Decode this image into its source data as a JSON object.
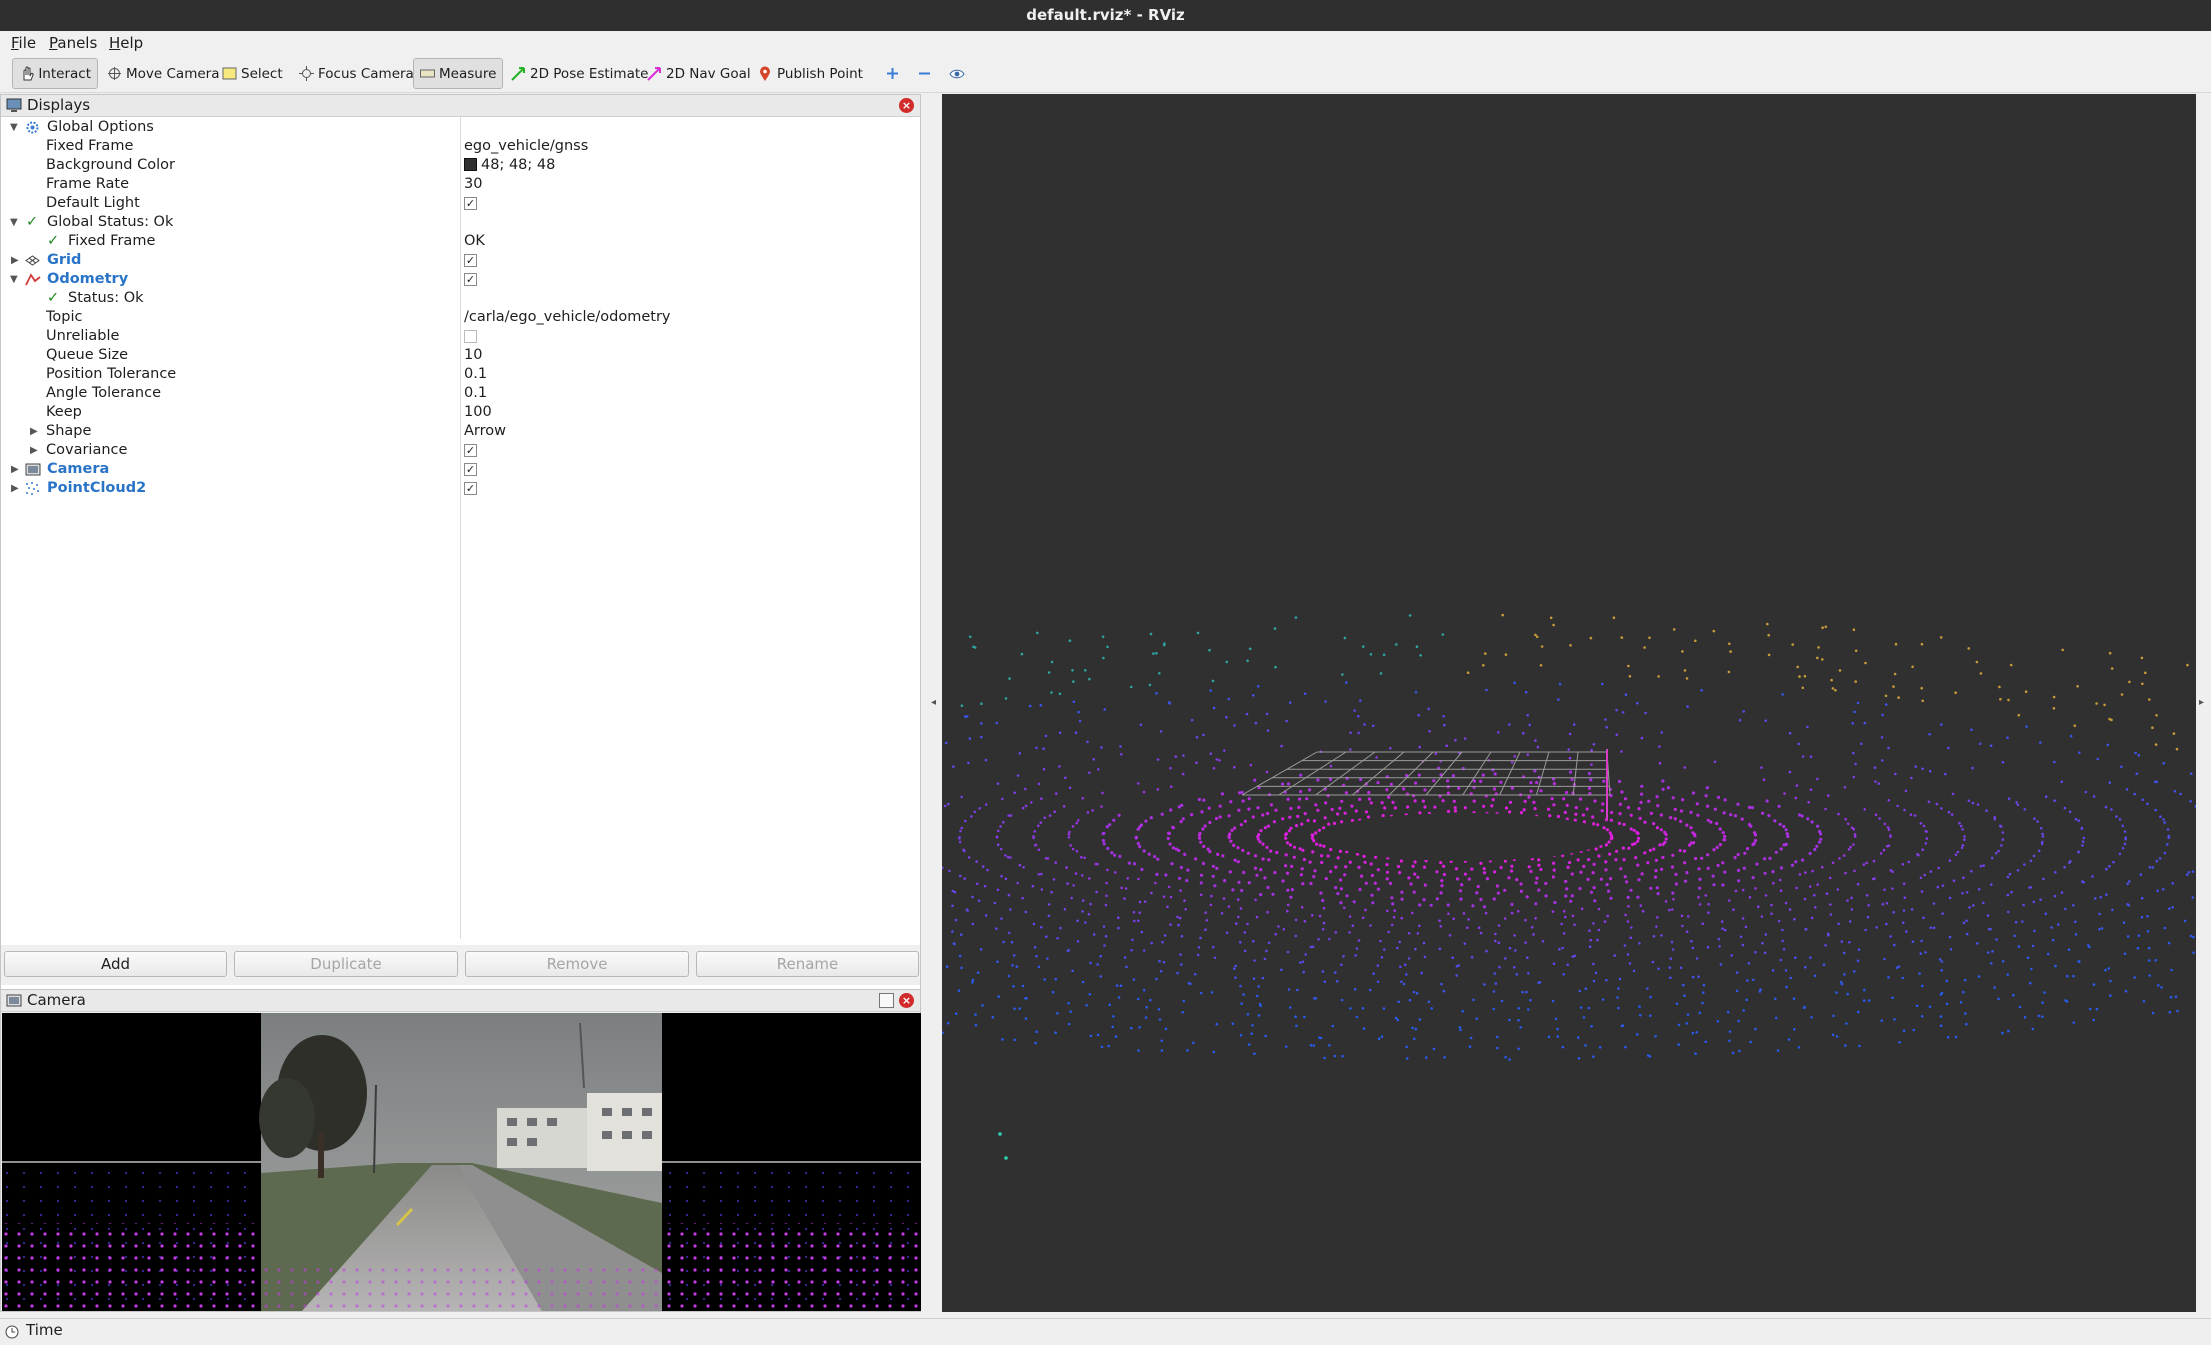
{
  "window": {
    "title": "default.rviz* - RViz"
  },
  "menu": {
    "file": "File",
    "panels": "Panels",
    "help": "Help"
  },
  "toolbar": {
    "interact": "Interact",
    "move_camera": "Move Camera",
    "select": "Select",
    "focus_camera": "Focus Camera",
    "measure": "Measure",
    "pose_estimate": "2D Pose Estimate",
    "nav_goal": "2D Nav Goal",
    "publish_point": "Publish Point"
  },
  "displays": {
    "title": "Displays",
    "global_options": "Global Options",
    "fixed_frame_label": "Fixed Frame",
    "fixed_frame_value": "ego_vehicle/gnss",
    "background_color_label": "Background Color",
    "background_color_value": "48; 48; 48",
    "frame_rate_label": "Frame Rate",
    "frame_rate_value": "30",
    "default_light_label": "Default Light",
    "global_status": "Global Status: Ok",
    "status_fixed_frame_label": "Fixed Frame",
    "status_fixed_frame_value": "OK",
    "grid": "Grid",
    "odometry": "Odometry",
    "odometry_status": "Status: Ok",
    "topic_label": "Topic",
    "topic_value": "/carla/ego_vehicle/odometry",
    "unreliable_label": "Unreliable",
    "queue_size_label": "Queue Size",
    "queue_size_value": "10",
    "position_tolerance_label": "Position Tolerance",
    "position_tolerance_value": "0.1",
    "angle_tolerance_label": "Angle Tolerance",
    "angle_tolerance_value": "0.1",
    "keep_label": "Keep",
    "keep_value": "100",
    "shape_label": "Shape",
    "shape_value": "Arrow",
    "covariance_label": "Covariance",
    "camera": "Camera",
    "pointcloud": "PointCloud2"
  },
  "buttons": {
    "add": "Add",
    "duplicate": "Duplicate",
    "remove": "Remove",
    "rename": "Rename"
  },
  "camera_panel": {
    "title": "Camera"
  },
  "time_panel": {
    "title": "Time"
  },
  "colors": {
    "background": "#303030",
    "pointcloud": "#d81fd8",
    "accent_blue": "#2a74c8",
    "ok_green": "#1f8a1f"
  }
}
